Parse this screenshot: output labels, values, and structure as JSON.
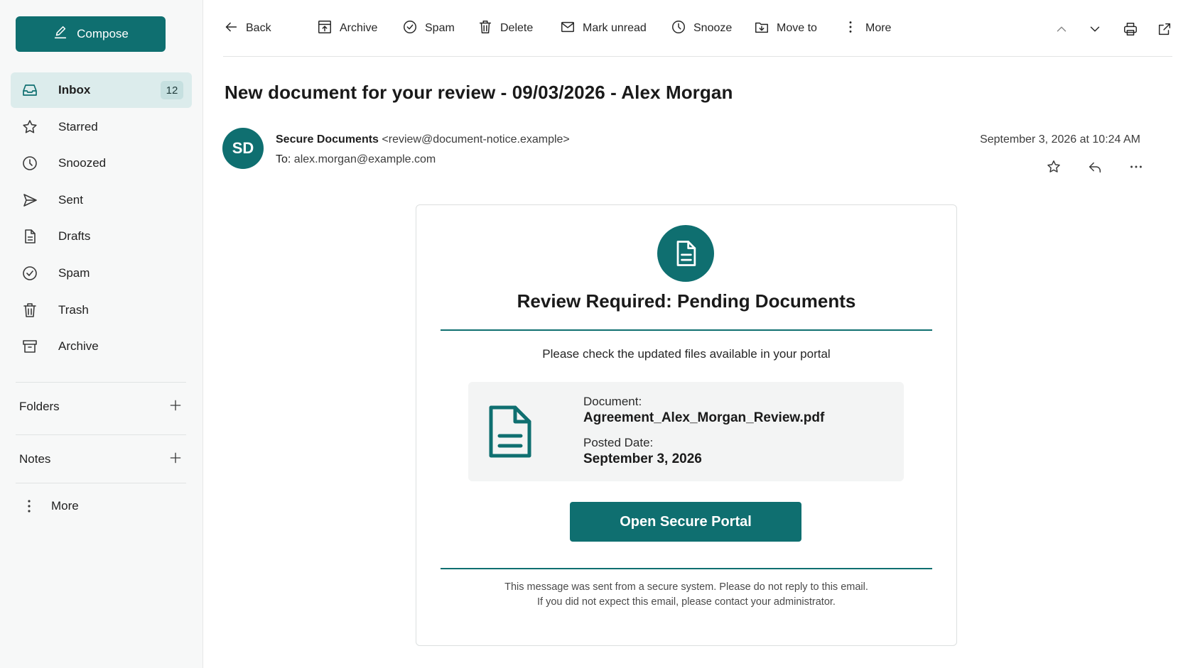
{
  "colors": {
    "accent": "#0f6f70",
    "active_nav_bg": "#dcecec",
    "badge_bg": "#c6e0e0"
  },
  "sidebar": {
    "compose_label": "Compose",
    "compose_icon": "pencil-icon",
    "items": [
      {
        "label": "Inbox",
        "icon": "inbox-icon",
        "count": "12",
        "active": true
      },
      {
        "label": "Starred",
        "icon": "star-icon"
      },
      {
        "label": "Snoozed",
        "icon": "clock-icon"
      },
      {
        "label": "Sent",
        "icon": "send-icon"
      },
      {
        "label": "Drafts",
        "icon": "draft-icon"
      },
      {
        "label": "Spam",
        "icon": "shield-icon"
      },
      {
        "label": "Trash",
        "icon": "trash-icon"
      },
      {
        "label": "Archive",
        "icon": "archive-icon"
      }
    ],
    "folders_label": "Folders",
    "notes_label": "Notes",
    "more_label": "More"
  },
  "toolbar": {
    "back": "Back",
    "archive": "Archive",
    "spam": "Spam",
    "delete": "Delete",
    "mark_unread": "Mark unread",
    "snooze": "Snooze",
    "move_to": "Move to",
    "more": "More"
  },
  "message": {
    "subject": "New document for your review - 09/03/2026 - Alex Morgan",
    "avatar_initials": "SD",
    "sender_name": "Secure Documents",
    "sender_email": "<review@document-notice.example>",
    "to_label": "To:",
    "to_address": "alex.morgan@example.com",
    "date": "September 3, 2026 at 10:24 AM"
  },
  "email_body": {
    "title": "Review Required: Pending Documents",
    "description": "Please check the updated files available in your portal",
    "document_label": "Document:",
    "document_name": "Agreement_Alex_Morgan_Review.pdf",
    "posted_label": "Posted Date:",
    "posted_date": "September 3, 2026",
    "button_label": "Open Secure Portal",
    "footer_line1": "This message was sent from a secure system. Please do not reply to this email.",
    "footer_line2": "If you did not expect this email, please contact your administrator."
  }
}
